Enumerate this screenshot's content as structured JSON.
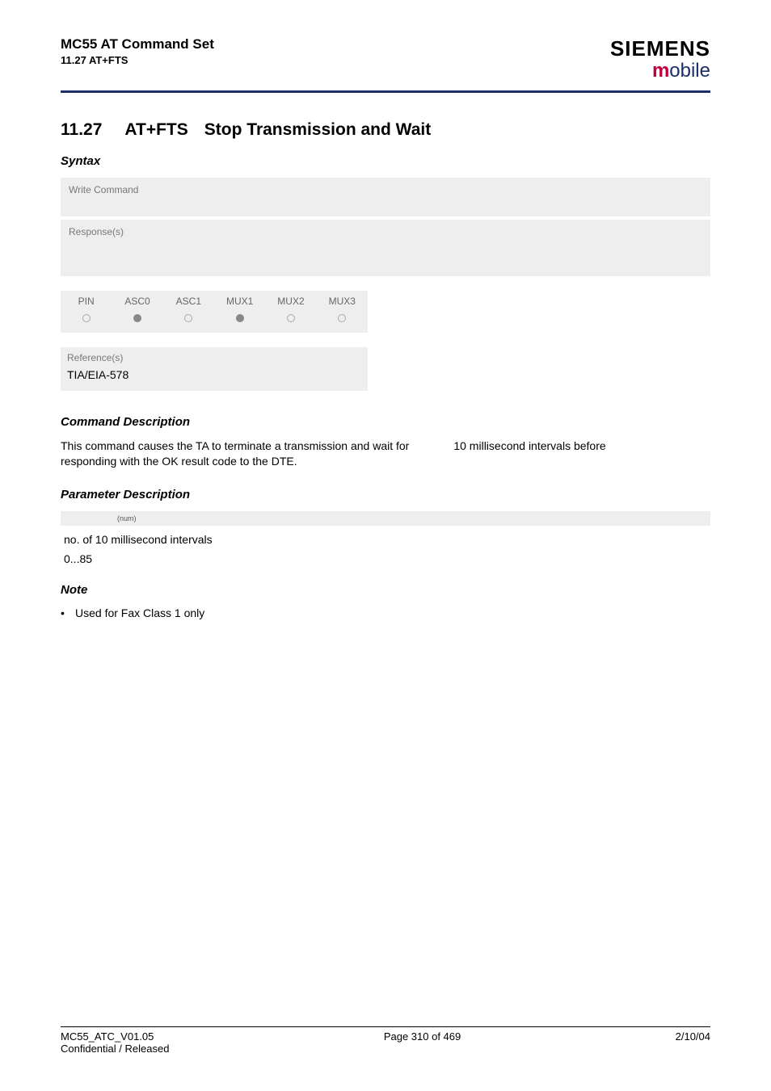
{
  "header": {
    "title": "MC55 AT Command Set",
    "sub": "11.27 AT+FTS",
    "brand": "SIEMENS",
    "brand_sub_m": "m",
    "brand_sub_rest": "obile"
  },
  "section": {
    "number": "11.27",
    "command": "AT+FTS",
    "title": "Stop Transmission and Wait"
  },
  "labels": {
    "syntax": "Syntax",
    "write_cmd": "Write Command",
    "responses": "Response(s)",
    "cmd_desc": "Command Description",
    "param_desc": "Parameter Description",
    "note": "Note",
    "references": "Reference(s)"
  },
  "mux": {
    "cols": [
      "PIN",
      "ASC0",
      "ASC1",
      "MUX1",
      "MUX2",
      "MUX3"
    ],
    "vals": [
      "empty",
      "filled",
      "empty",
      "filled",
      "empty",
      "empty"
    ]
  },
  "reference_value": "TIA/EIA-578",
  "cmd_desc_line1a": "This command causes the TA to terminate a transmission and wait for",
  "cmd_desc_line1b": "10 millisecond intervals before",
  "cmd_desc_line2": "responding with the OK result code to the DTE.",
  "param": {
    "tag": "(num)",
    "line1": "no. of 10 millisecond intervals",
    "line2": "0...85"
  },
  "note_item": "Used for Fax Class 1 only",
  "footer": {
    "l1": "MC55_ATC_V01.05",
    "l2": "Confidential / Released",
    "center": "Page 310 of 469",
    "right": "2/10/04"
  }
}
